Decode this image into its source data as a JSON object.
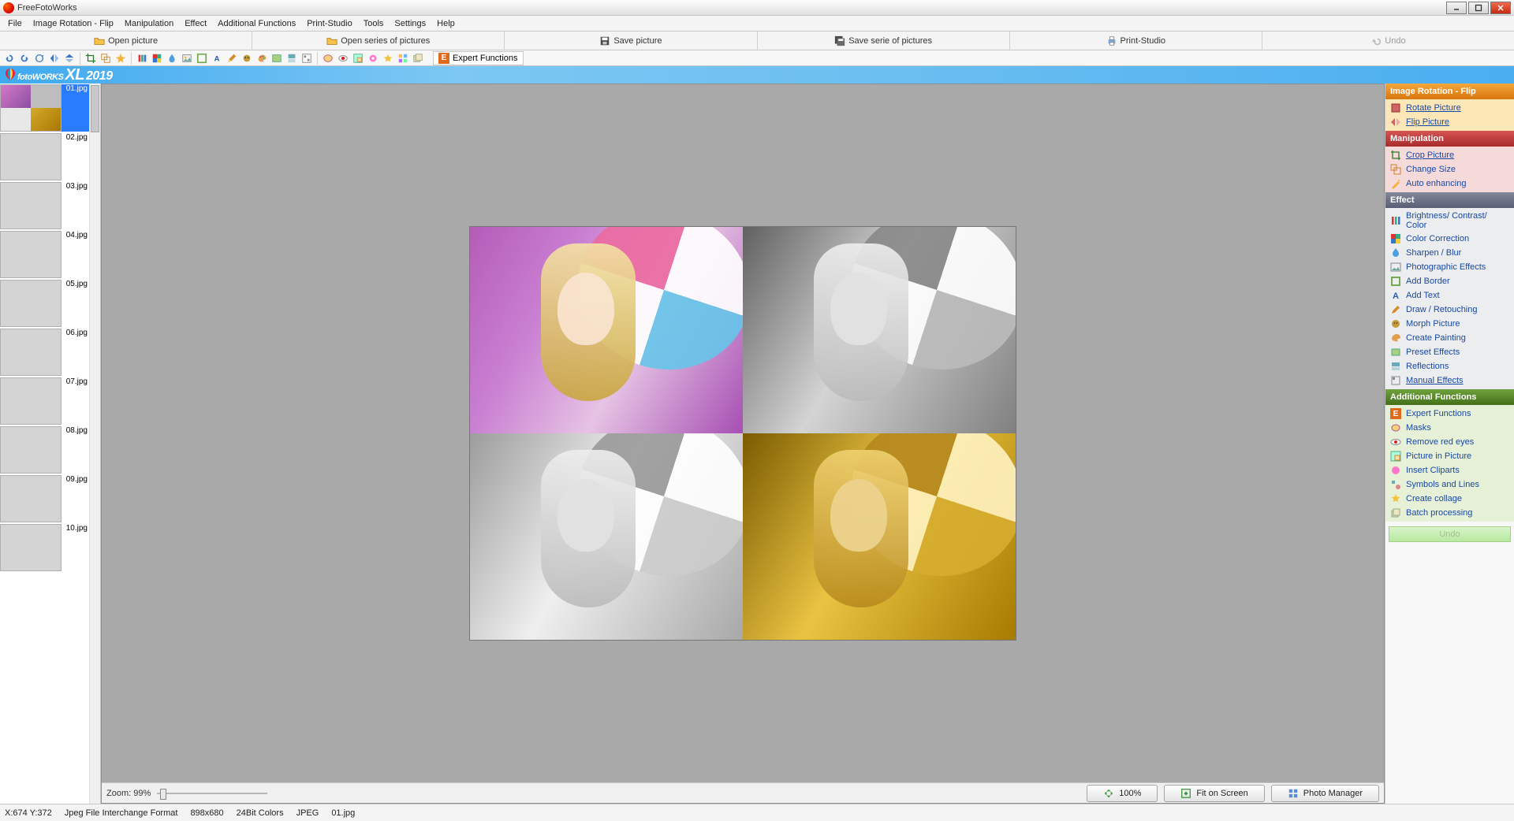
{
  "titlebar": {
    "title": "FreeFotoWorks"
  },
  "menubar": [
    "File",
    "Image Rotation - Flip",
    "Manipulation",
    "Effect",
    "Additional Functions",
    "Print-Studio",
    "Tools",
    "Settings",
    "Help"
  ],
  "toolbar1": {
    "open_picture": "Open picture",
    "open_series": "Open series of pictures",
    "save_picture": "Save picture",
    "save_series": "Save serie of pictures",
    "print_studio": "Print-Studio",
    "undo": "Undo"
  },
  "expert_btn": "Expert Functions",
  "logo": {
    "brand_a": "foto",
    "brand_b": "WORKS",
    "xl": "XL",
    "year": "2019"
  },
  "thumbs": [
    "01.jpg",
    "02.jpg",
    "03.jpg",
    "04.jpg",
    "05.jpg",
    "06.jpg",
    "07.jpg",
    "08.jpg",
    "09.jpg",
    "10.jpg"
  ],
  "canvas_bottom": {
    "zoom_label": "Zoom: 99%",
    "btn_100": "100%",
    "btn_fit": "Fit on Screen",
    "btn_pm": "Photo Manager"
  },
  "right": {
    "h1": "Image Rotation - Flip",
    "g1": [
      "Rotate Picture",
      "Flip Picture"
    ],
    "h2": "Manipulation",
    "g2": [
      "Crop Picture",
      "Change Size",
      "Auto enhancing"
    ],
    "h3": "Effect",
    "g3": [
      "Brightness/ Contrast/ Color",
      "Color Correction",
      "Sharpen / Blur",
      "Photographic Effects",
      "Add Border",
      "Add Text",
      "Draw / Retouching",
      "Morph Picture",
      "Create Painting",
      "Preset Effects",
      "Reflections",
      "Manual Effects"
    ],
    "h4": "Additional Functions",
    "g4": [
      "Expert Functions",
      "Masks",
      "Remove red eyes",
      "Picture in Picture",
      "Insert Cliparts",
      "Symbols and Lines",
      "Create collage",
      "Batch processing"
    ],
    "undo": "Undo"
  },
  "status": {
    "coords": "X:674 Y:372",
    "format": "Jpeg File Interchange Format",
    "dims": "898x680",
    "depth": "24Bit Colors",
    "type": "JPEG",
    "fname": "01.jpg"
  }
}
